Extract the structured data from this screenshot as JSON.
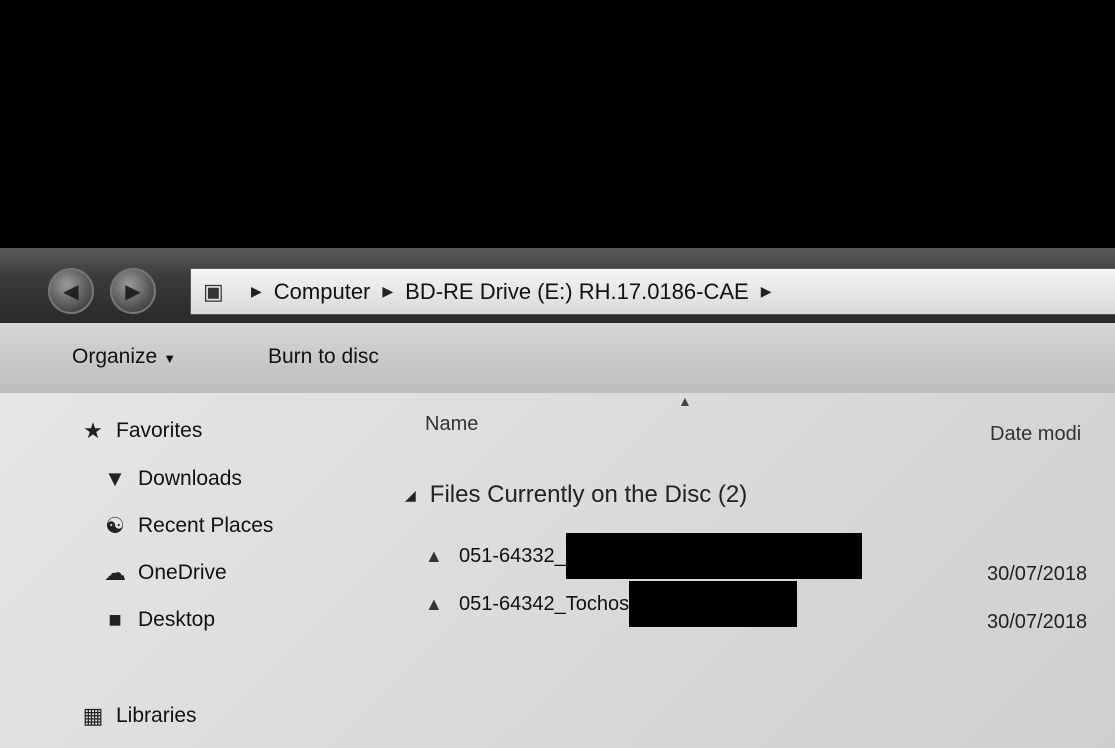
{
  "address_bar": {
    "crumbs": [
      "Computer",
      "BD-RE Drive (E:) RH.17.0186-CAE"
    ]
  },
  "toolbar": {
    "organize_label": "Organize",
    "burn_label": "Burn to disc"
  },
  "nav_pane": {
    "favorites_label": "Favorites",
    "items": [
      {
        "label": "Downloads",
        "icon": "downloads-icon"
      },
      {
        "label": "Recent Places",
        "icon": "recent-places-icon"
      },
      {
        "label": "OneDrive",
        "icon": "cloud-icon"
      },
      {
        "label": "Desktop",
        "icon": "desktop-icon"
      }
    ],
    "libraries_label": "Libraries"
  },
  "file_list": {
    "columns": {
      "name": "Name",
      "date": "Date modi"
    },
    "group_label": "Files Currently on the Disc (2)",
    "files": [
      {
        "name": "051-64332_",
        "date": "30/07/2018"
      },
      {
        "name": "051-64342_Tochos",
        "date": "30/07/2018"
      }
    ]
  },
  "colors": {
    "redaction": "#000000",
    "title_bar": "#3a3a3a"
  }
}
